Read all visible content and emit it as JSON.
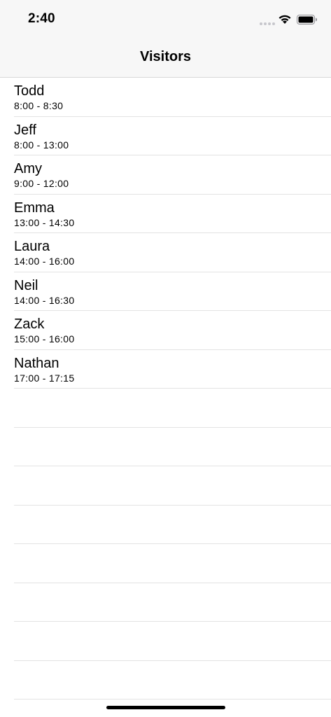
{
  "status": {
    "time": "2:40",
    "icons": [
      "signal-dots-icon",
      "wifi-icon",
      "battery-icon"
    ]
  },
  "nav": {
    "title": "Visitors"
  },
  "visitors": [
    {
      "name": "Todd",
      "time": "8:00 - 8:30"
    },
    {
      "name": "Jeff",
      "time": "8:00 - 13:00"
    },
    {
      "name": "Amy",
      "time": "9:00 - 12:00"
    },
    {
      "name": "Emma",
      "time": "13:00 - 14:30"
    },
    {
      "name": "Laura",
      "time": "14:00 - 16:00"
    },
    {
      "name": "Neil",
      "time": "14:00 - 16:30"
    },
    {
      "name": "Zack",
      "time": "15:00 - 16:00"
    },
    {
      "name": "Nathan",
      "time": "17:00 - 17:15"
    }
  ],
  "colors": {
    "bar_background": "#f7f7f7",
    "separator": "#e3e3e3",
    "text": "#000000"
  }
}
